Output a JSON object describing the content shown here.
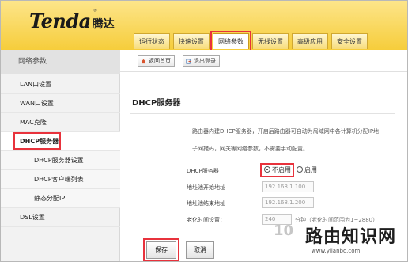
{
  "brand": {
    "logo_en": "Tenda",
    "logo_cn": "腾达",
    "trademark": "®"
  },
  "tabs": [
    "运行状态",
    "快速设置",
    "网络参数",
    "无线设置",
    "高级应用",
    "安全设置"
  ],
  "active_tab_index": 2,
  "toolbar": {
    "back_label": "返回首页",
    "logout_label": "退出登录"
  },
  "sidebar": {
    "title": "网络参数",
    "items": [
      {
        "label": "LAN口设置"
      },
      {
        "label": "WAN口设置"
      },
      {
        "label": "MAC克隆"
      },
      {
        "label": "DHCP服务器"
      },
      {
        "label": "DHCP服务器设置"
      },
      {
        "label": "DHCP客户端列表"
      },
      {
        "label": "静态分配IP"
      },
      {
        "label": "DSL设置"
      }
    ]
  },
  "main": {
    "panel_title": "DHCP服务器",
    "description_line1": "路由器内建DHCP服务器，开启后路由器可自动为局域网中各计算机分配IP地",
    "description_line2": "子网掩码，网关等网络参数，不需要手动配置。",
    "dhcp_label": "DHCP服务器",
    "radio_off": "不启用",
    "radio_on": "启用",
    "start_label": "地址池开始地址",
    "start_value": "192.168.1.100",
    "end_label": "地址池结束地址",
    "end_value": "192.168.1.200",
    "lease_label": "老化时间设置：",
    "lease_value": "240",
    "lease_hint": "分钟（老化时间范围为1~2880）",
    "save_label": "保存",
    "cancel_label": "取消"
  },
  "watermark": {
    "prefix": "10",
    "cn": "路由知识网",
    "url": "www.yilanbo.com"
  },
  "colors": {
    "header": "#f6cd3b",
    "highlight": "#e8323c"
  }
}
